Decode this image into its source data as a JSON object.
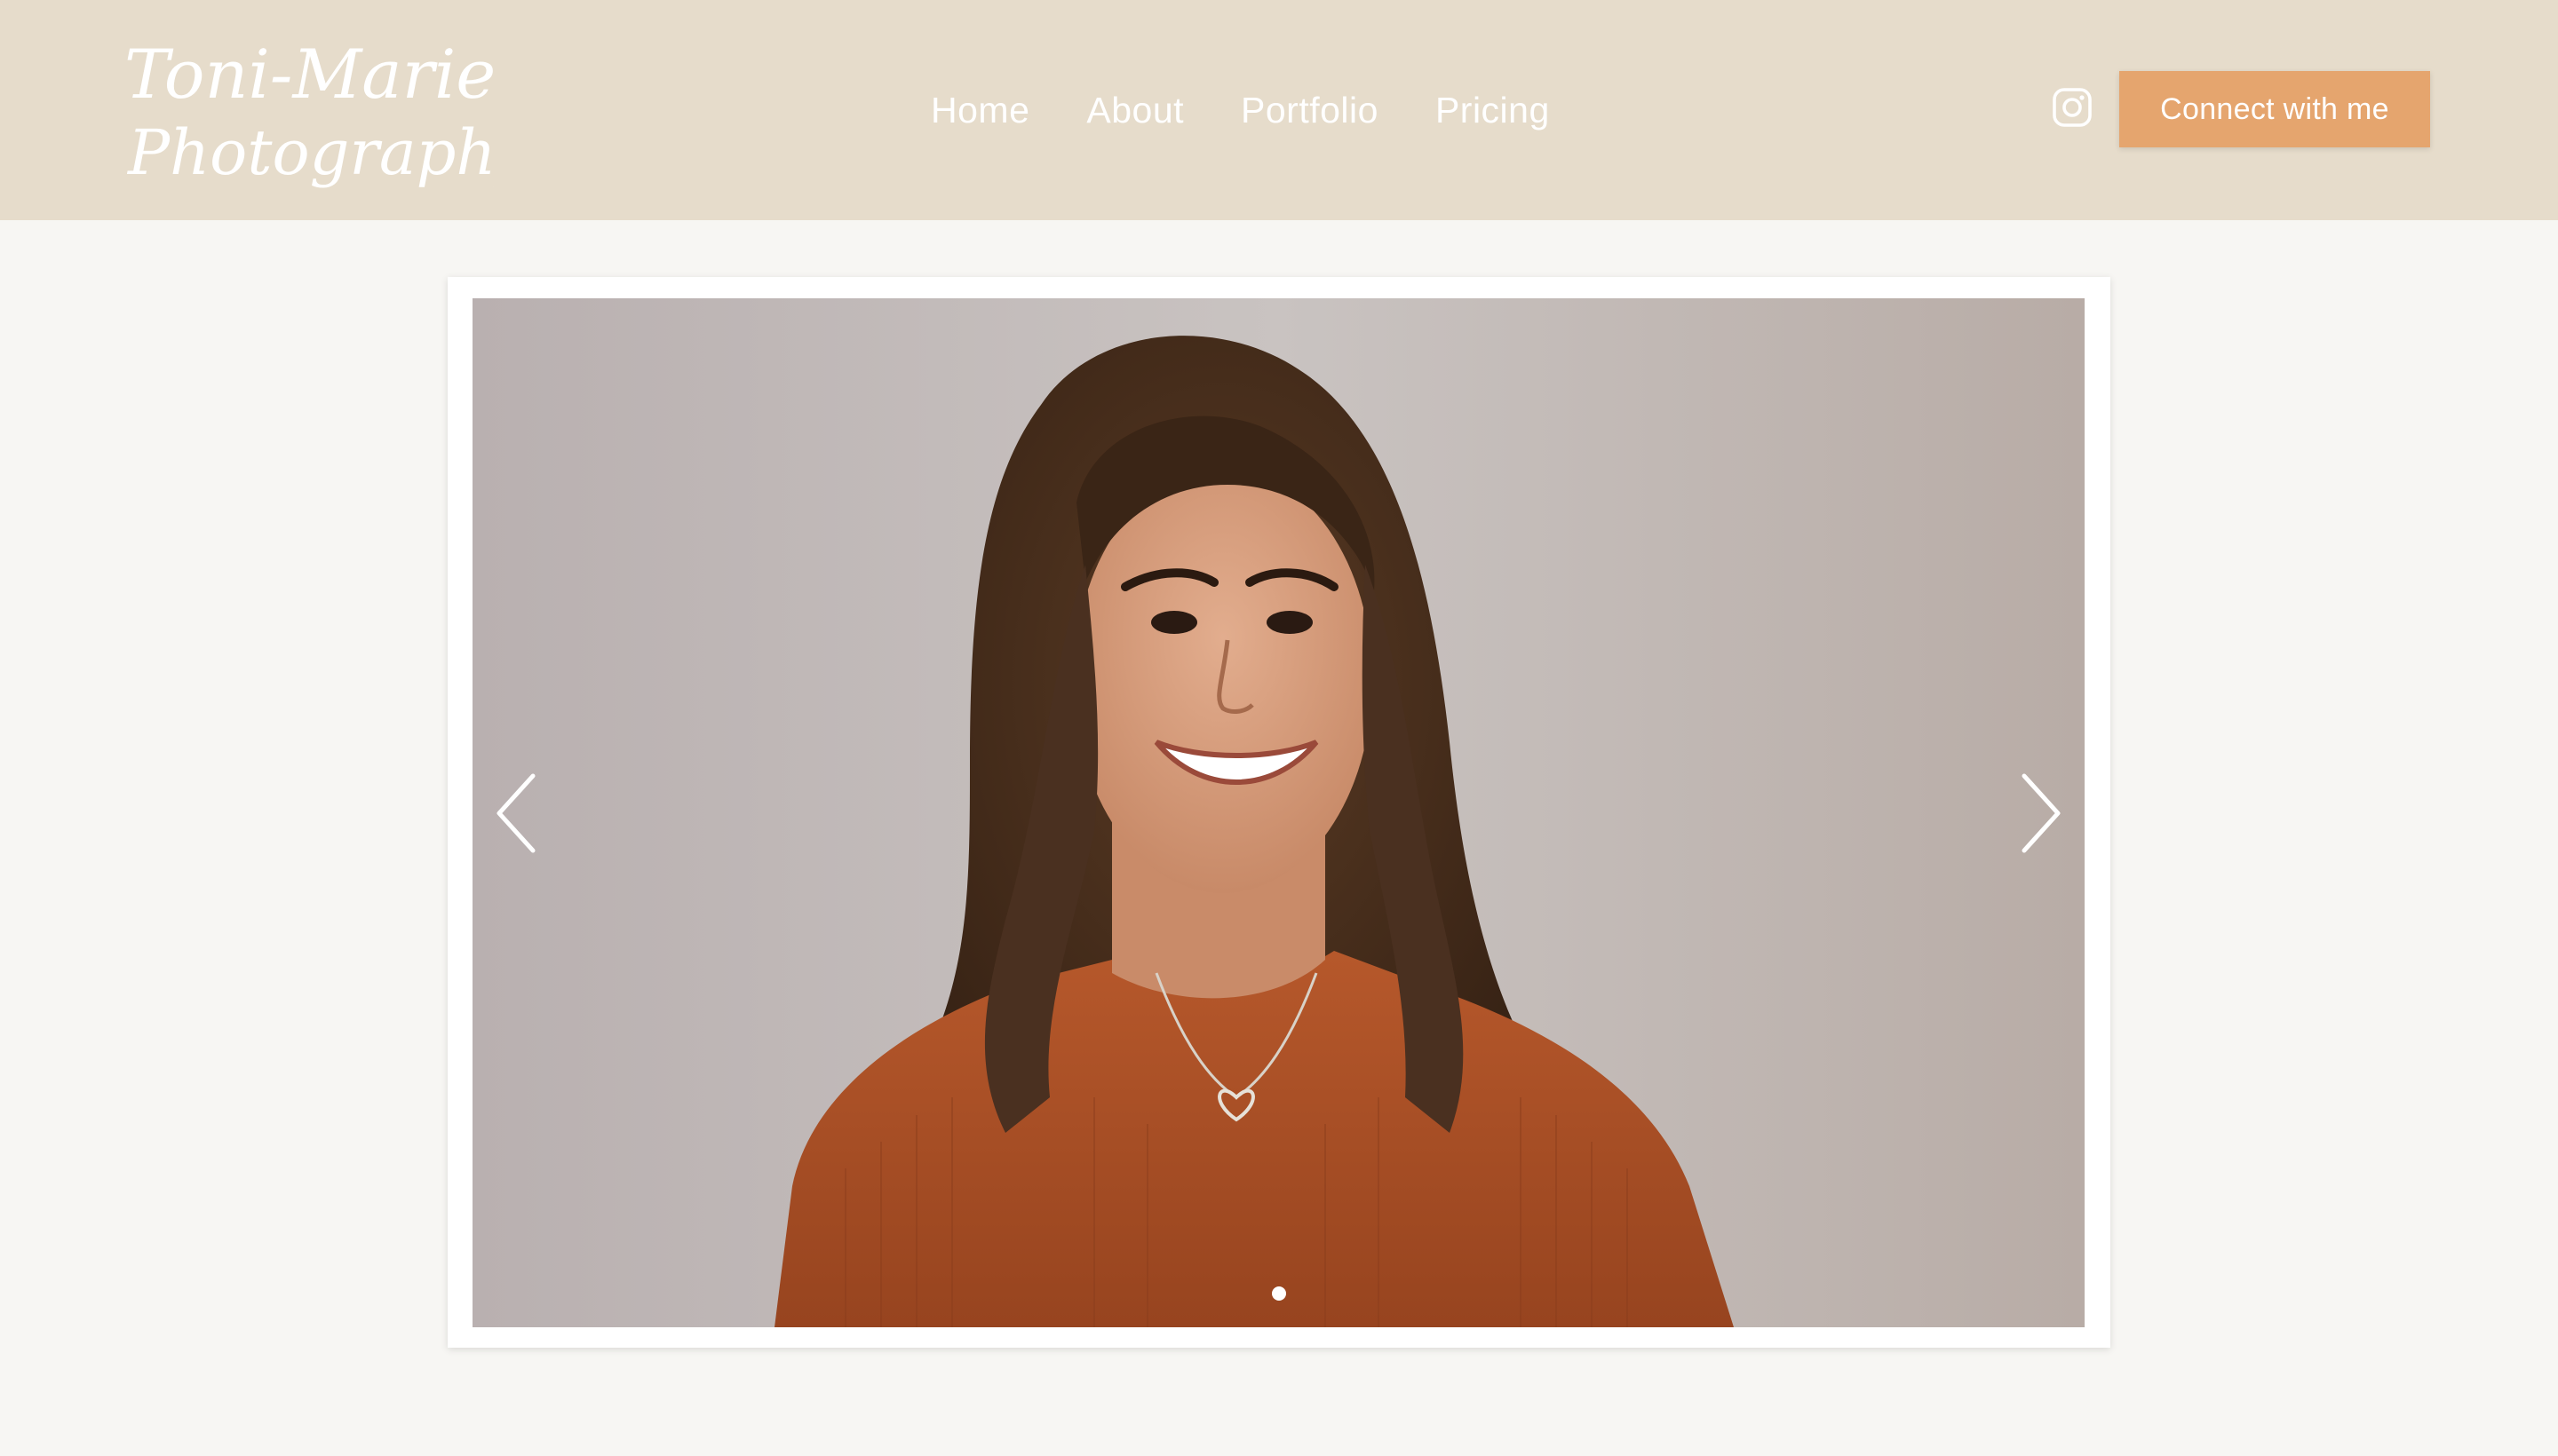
{
  "brand": {
    "logo_line1": "Toni-Marie",
    "logo_line2": "Photography"
  },
  "nav": {
    "items": [
      {
        "label": "Home"
      },
      {
        "label": "About"
      },
      {
        "label": "Portfolio"
      },
      {
        "label": "Pricing"
      }
    ]
  },
  "header": {
    "social_icon": "instagram-icon",
    "cta_label": "Connect with me"
  },
  "gallery": {
    "prev_icon": "chevron-left-icon",
    "next_icon": "chevron-right-icon",
    "slide_count": 1,
    "active_slide": 1
  },
  "colors": {
    "header_bg": "#e6dccb",
    "page_bg": "#f7f6f3",
    "accent": "#e5a56e",
    "text_light": "#ffffff"
  }
}
